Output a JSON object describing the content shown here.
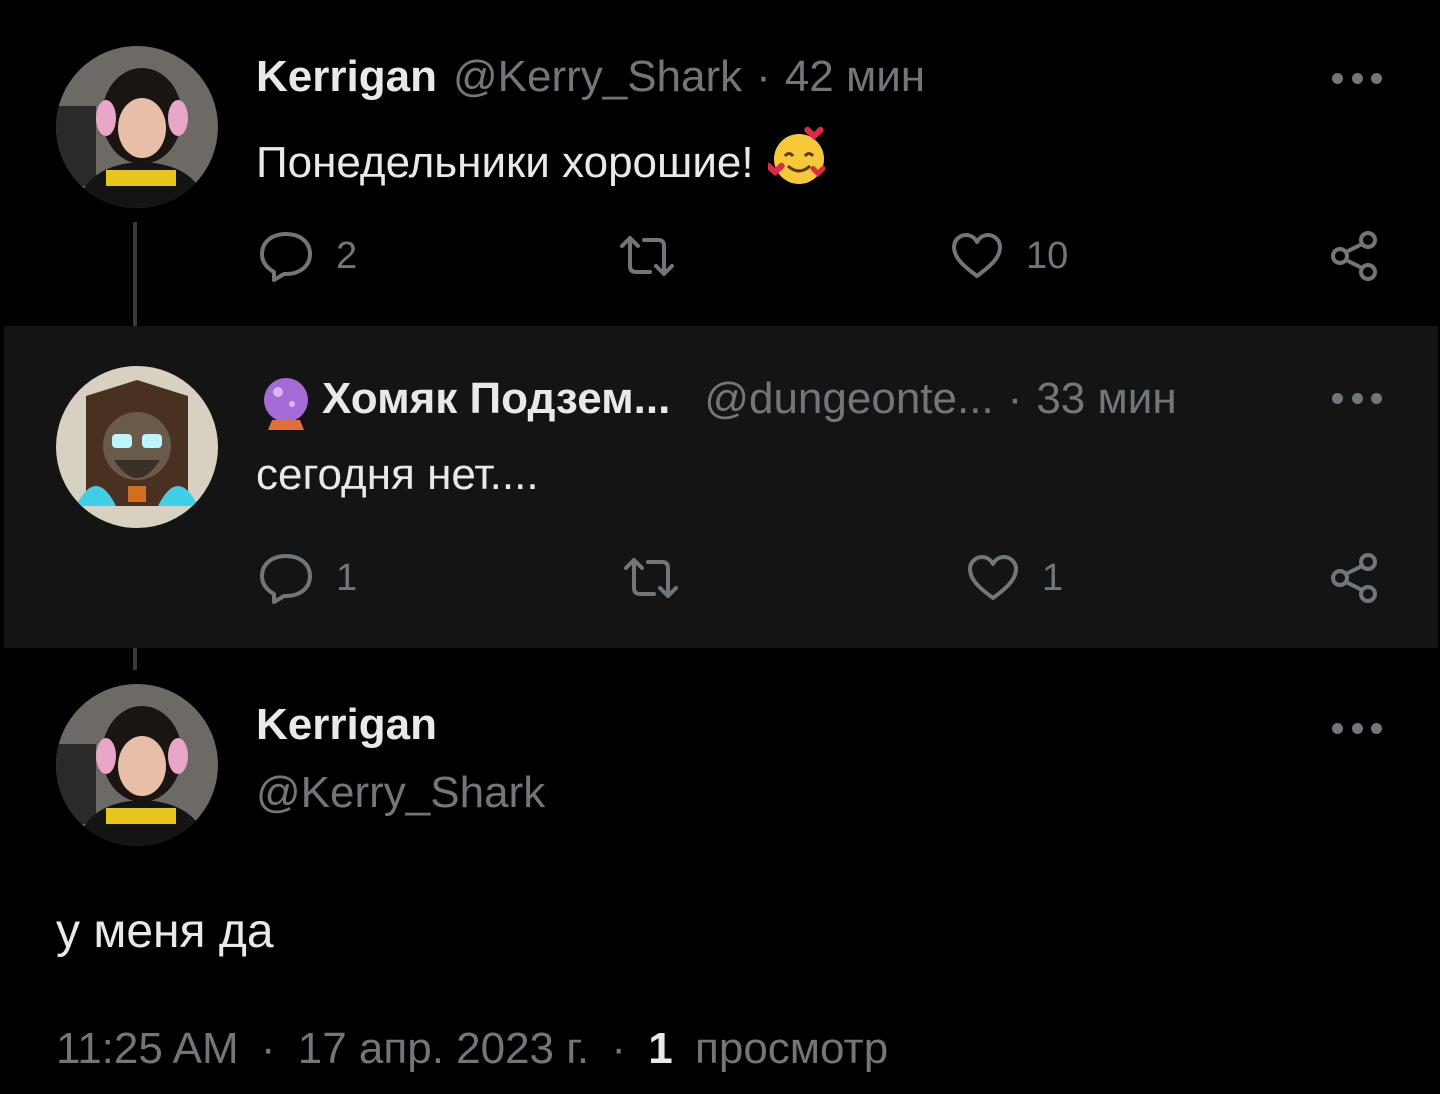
{
  "tweet1": {
    "name": "Kerrigan",
    "handle": "@Kerry_Shark",
    "separator": "·",
    "time": "42 мин",
    "text": "Понедельники хорошие!",
    "emoji": "smiling-face-with-hearts",
    "replies": "2",
    "retweets": "",
    "likes": "10"
  },
  "tweet2": {
    "name_emoji": "crystal-ball",
    "name": "Хомяк Подзем...",
    "handle": "@dungeonte...",
    "separator": "·",
    "time": "33 мин",
    "text": "сегодня нет....",
    "replies": "1",
    "retweets": "",
    "likes": "1"
  },
  "main": {
    "name": "Kerrigan",
    "handle": "@Kerry_Shark",
    "text": "у меня да",
    "time": "11:25 AM",
    "sep1": "·",
    "date": "17 апр. 2023 г.",
    "sep2": "·",
    "views_count": "1",
    "views_label": "просмотр"
  },
  "colors": {
    "background": "#000000",
    "highlight_row": "#141414",
    "text_primary": "#e7e9ea",
    "text_secondary": "#71767b"
  }
}
